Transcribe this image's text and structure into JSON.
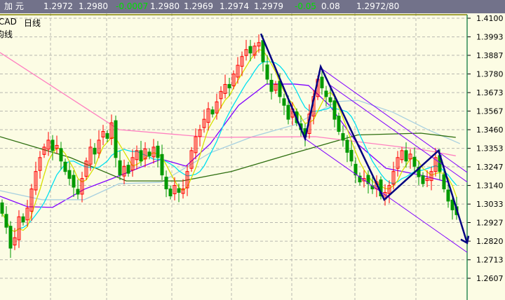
{
  "header": {
    "name": "加  元",
    "fields": [
      "1.2972",
      "1.2980",
      "-0.0007",
      "1.2980",
      "1.2969",
      "1.2974",
      "1.2979",
      "-0.05",
      "0.08",
      "1.2972/80"
    ],
    "negative": [
      false,
      false,
      true,
      false,
      false,
      false,
      false,
      true,
      false,
      false
    ]
  },
  "labels": {
    "symbol": "CAD",
    "period": "日线",
    "indicator": "均线"
  },
  "colors": {
    "up": "#ff0000",
    "down": "#009900",
    "ma5": "#d8e000",
    "ma10": "#00e0f0",
    "ma20": "#8000ff",
    "ma30": "#a8d0e0",
    "ma60": "#2e6e10",
    "ma120": "#ff80c0",
    "trend": "#000080",
    "channel": "#8000ff",
    "background": "#fcfce4",
    "header": "#72728a"
  },
  "chart_data": {
    "type": "candlestick",
    "ylim": [
      1.254,
      1.417
    ],
    "yticks": [
      "1.4100",
      "1.3993",
      "1.3887",
      "1.3780",
      "1.3673",
      "1.3567",
      "1.3460",
      "1.3353",
      "1.3247",
      "1.3140",
      "1.3033",
      "1.2927",
      "1.2820",
      "1.2713",
      "1.2607"
    ],
    "grid": true,
    "closes": [
      1.298,
      1.29,
      1.278,
      1.284,
      1.296,
      1.293,
      1.301,
      1.312,
      1.322,
      1.33,
      1.336,
      1.34,
      1.334,
      1.337,
      1.328,
      1.322,
      1.318,
      1.313,
      1.309,
      1.318,
      1.328,
      1.336,
      1.332,
      1.34,
      1.345,
      1.341,
      1.35,
      1.33,
      1.32,
      1.325,
      1.321,
      1.33,
      1.334,
      1.328,
      1.335,
      1.331,
      1.336,
      1.33,
      1.32,
      1.312,
      1.308,
      1.314,
      1.31,
      1.312,
      1.322,
      1.334,
      1.342,
      1.346,
      1.352,
      1.358,
      1.355,
      1.362,
      1.368,
      1.372,
      1.37,
      1.378,
      1.383,
      1.388,
      1.392,
      1.39,
      1.394,
      1.396,
      1.385,
      1.375,
      1.368,
      1.372,
      1.365,
      1.36,
      1.352,
      1.358,
      1.35,
      1.346,
      1.342,
      1.355,
      1.365,
      1.375,
      1.37,
      1.365,
      1.362,
      1.352,
      1.345,
      1.34,
      1.333,
      1.328,
      1.32,
      1.316,
      1.318,
      1.315,
      1.312,
      1.316,
      1.308,
      1.31,
      1.314,
      1.322,
      1.33,
      1.334,
      1.328,
      1.332,
      1.325,
      1.319,
      1.315,
      1.318,
      1.322,
      1.33,
      1.322,
      1.312,
      1.305,
      1.3,
      1.2972
    ],
    "moving_averages": [
      {
        "key": "ma20",
        "points": [
          [
            -0.5,
            1.3078
          ],
          [
            6,
            1.3018
          ],
          [
            12,
            1.3014
          ],
          [
            19.5,
            1.3118
          ],
          [
            26,
            1.3178
          ],
          [
            37.8,
            1.3291
          ],
          [
            43.7,
            1.3251
          ],
          [
            49.5,
            1.338
          ],
          [
            56.2,
            1.36
          ],
          [
            62.8,
            1.3722
          ],
          [
            69.5,
            1.3722
          ],
          [
            72.8,
            1.3714
          ],
          [
            77.8,
            1.36
          ],
          [
            84.5,
            1.3378
          ],
          [
            91.2,
            1.3239
          ],
          [
            99.5,
            1.3199
          ],
          [
            106.2,
            1.3158
          ]
        ]
      },
      {
        "key": "ma30",
        "points": [
          [
            -0.5,
            1.311
          ],
          [
            9.5,
            1.3058
          ],
          [
            19.5,
            1.3058
          ],
          [
            27.8,
            1.315
          ],
          [
            37.8,
            1.3158
          ],
          [
            49.5,
            1.3328
          ],
          [
            59.5,
            1.342
          ],
          [
            69.5,
            1.3488
          ],
          [
            79.5,
            1.3621
          ],
          [
            84.5,
            1.3629
          ],
          [
            92.8,
            1.3561
          ],
          [
            101.2,
            1.346
          ],
          [
            108.8,
            1.338
          ]
        ]
      },
      {
        "key": "ma60",
        "points": [
          [
            -0.5,
            1.342
          ],
          [
            16.2,
            1.33
          ],
          [
            29.5,
            1.3166
          ],
          [
            42.8,
            1.3166
          ],
          [
            54.5,
            1.322
          ],
          [
            69.5,
            1.3327
          ],
          [
            84.5,
            1.343
          ],
          [
            99.5,
            1.344
          ],
          [
            107.8,
            1.3416
          ]
        ]
      },
      {
        "key": "ma120",
        "points": [
          [
            -0.5,
            1.3903
          ],
          [
            27.8,
            1.346
          ],
          [
            49.5,
            1.3416
          ],
          [
            74.5,
            1.342
          ],
          [
            99.5,
            1.3347
          ],
          [
            107.8,
            1.331
          ]
        ]
      }
    ],
    "trend_line": [
      [
        61.5,
        1.4011
      ],
      [
        72,
        1.3408
      ],
      [
        75.7,
        1.3822
      ],
      [
        90.8,
        1.3058
      ],
      [
        103.7,
        1.334
      ],
      [
        110.5,
        1.281
      ]
    ],
    "channel_lines": [
      [
        [
          75.7,
          1.3814
        ],
        [
          110.5,
          1.3215
        ]
      ],
      [
        [
          77.8,
          1.3718
        ],
        [
          110.5,
          1.316
        ]
      ],
      [
        [
          72,
          1.3408
        ],
        [
          110.5,
          1.2756
        ]
      ]
    ]
  }
}
